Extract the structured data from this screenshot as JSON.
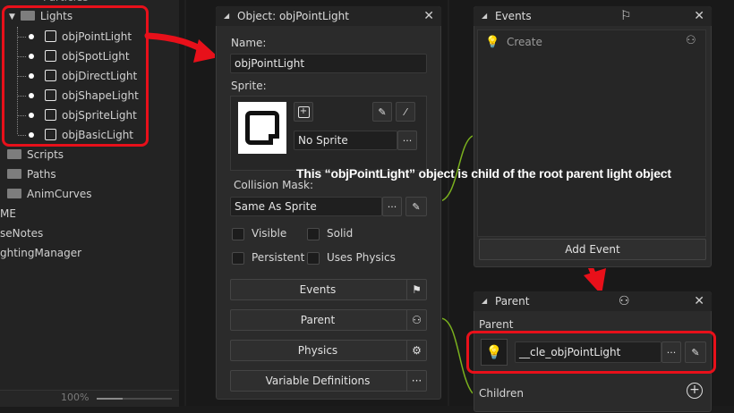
{
  "tree": {
    "top_partial": "Particles",
    "lights_folder": "Lights",
    "items": [
      "objPointLight",
      "objSpotLight",
      "objDirectLight",
      "objShapeLight",
      "objSpriteLight",
      "objBasicLight"
    ],
    "folders": [
      "Scripts",
      "Paths",
      "AnimCurves"
    ],
    "root_items": [
      "ME",
      "seNotes",
      "ghtingManager"
    ],
    "zoom": "100%",
    "zoom_level": 0.35
  },
  "object_window": {
    "title": "Object: objPointLight",
    "name_label": "Name:",
    "name_value": "objPointLight",
    "sprite_label": "Sprite:",
    "sprite_value": "No Sprite",
    "collision_label": "Collision Mask:",
    "collision_value": "Same As Sprite",
    "checks": {
      "visible": "Visible",
      "solid": "Solid",
      "persistent": "Persistent",
      "physics": "Uses Physics"
    },
    "buttons": {
      "events": "Events",
      "parent": "Parent",
      "physics": "Physics",
      "variables": "Variable Definitions"
    },
    "ellipsis": "···"
  },
  "events_window": {
    "title": "Events",
    "event_item": "Create",
    "add_event": "Add Event"
  },
  "parent_window": {
    "title": "Parent",
    "parent_label": "Parent",
    "parent_value": "__cle_objPointLight",
    "children_label": "Children",
    "ellipsis": "···"
  },
  "annotation": "This “objPointLight” object is child of the root parent light object",
  "colors": {
    "highlight": "#e8101a",
    "connector": "#7ab01e"
  }
}
